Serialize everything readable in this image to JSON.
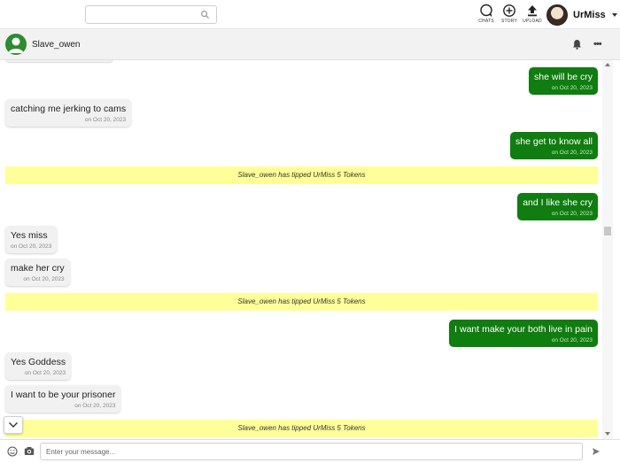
{
  "search": {
    "placeholder": ""
  },
  "nav": {
    "chats": "CHATS",
    "story": "STORY",
    "upload": "UPLOAD"
  },
  "user": {
    "name": "UrMiss"
  },
  "chat": {
    "contact": "Slave_owen"
  },
  "messages": {
    "m1": {
      "text": "she will be cry",
      "date": "on Oct 20, 2023"
    },
    "m2": {
      "text": "catching me jerking to cams",
      "date": "on Oct 20, 2023"
    },
    "m3": {
      "text": "she get to know all",
      "date": "on Oct 20, 2023"
    },
    "tip1": "Slave_owen has tipped UrMiss 5 Tokens",
    "m4": {
      "text": "and I like she cry",
      "date": "on Oct 20, 2023"
    },
    "m5": {
      "text": "Yes miss",
      "date": "on Oct 20, 2023"
    },
    "m6": {
      "text": "make her cry",
      "date": "on Oct 20, 2023"
    },
    "tip2": "Slave_owen has tipped UrMiss 5 Tokens",
    "m7": {
      "text": "I want make your both live in pain",
      "date": "on Oct 20, 2023"
    },
    "m8": {
      "text": "Yes Goddess",
      "date": "on Oct 20, 2023"
    },
    "m9": {
      "text": "I want to be your prisoner",
      "date": "on Oct 20, 2023"
    },
    "tip3": "Slave_owen has tipped UrMiss 5 Tokens"
  },
  "composer": {
    "placeholder": "Enter your message..."
  },
  "colors": {
    "outgoing": "#0f7d0f",
    "incoming": "#f1f1f1",
    "tip": "#ffff99"
  }
}
